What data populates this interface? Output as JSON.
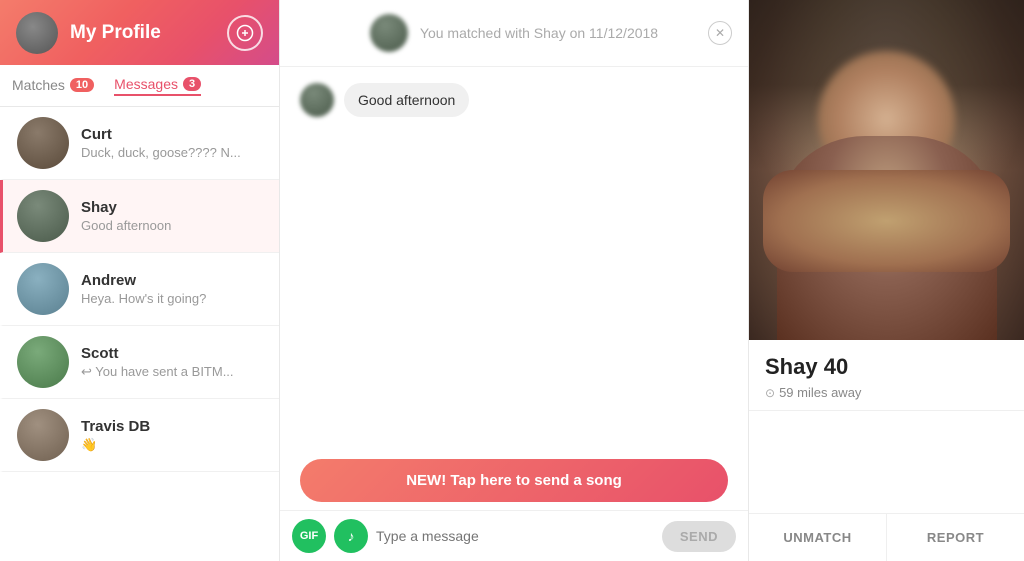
{
  "header": {
    "title": "My Profile",
    "icon": "user-icon"
  },
  "tabs": {
    "matches_label": "Matches",
    "matches_count": "10",
    "messages_label": "Messages",
    "messages_count": "3"
  },
  "match_list": [
    {
      "id": "curt",
      "name": "Curt",
      "preview": "Duck, duck, goose???? N...",
      "avatar_class": "avatar-curt",
      "active": false
    },
    {
      "id": "shay",
      "name": "Shay",
      "preview": "Good afternoon",
      "avatar_class": "avatar-shay",
      "active": true
    },
    {
      "id": "andrew",
      "name": "Andrew",
      "preview": "Heya. How's it going?",
      "avatar_class": "avatar-andrew",
      "active": false
    },
    {
      "id": "scott",
      "name": "Scott",
      "preview": "↩ You have sent a BITM...",
      "avatar_class": "avatar-scott",
      "active": false
    },
    {
      "id": "travis",
      "name": "Travis DB",
      "preview": "👋",
      "avatar_class": "avatar-travis",
      "active": false
    }
  ],
  "chat": {
    "match_banner": "You matched with Shay on 11/12/2018",
    "messages": [
      {
        "sender": "shay",
        "text": "Good afternoon"
      }
    ],
    "song_cta": "NEW! Tap here to send a song",
    "input_placeholder": "Type a message",
    "gif_label": "GIF",
    "music_icon": "♪",
    "send_label": "SEND"
  },
  "profile_panel": {
    "name": "Shay",
    "age": "40",
    "distance": "59 miles away",
    "unmatch_label": "UNMATCH",
    "report_label": "REPORT"
  }
}
